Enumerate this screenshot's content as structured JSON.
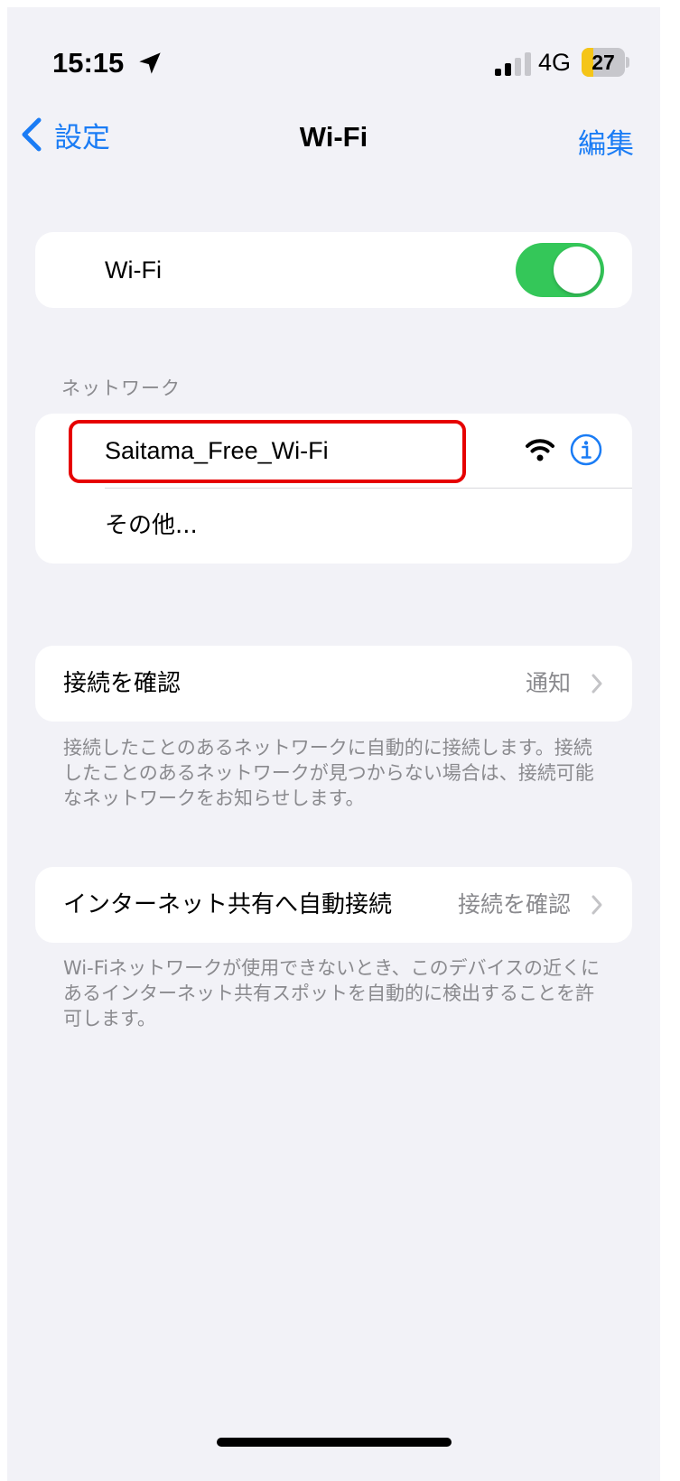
{
  "status_bar": {
    "time": "15:15",
    "network_type": "4G",
    "battery_level": "27",
    "battery_fraction": 0.27,
    "signal_bars_active": 2,
    "signal_bars_total": 4
  },
  "nav": {
    "back_label": "設定",
    "title": "Wi-Fi",
    "edit_label": "編集"
  },
  "wifi_toggle": {
    "label": "Wi-Fi",
    "on": true
  },
  "networks": {
    "header": "ネットワーク",
    "items": [
      {
        "name": "Saitama_Free_Wi-Fi",
        "icon": "wifi-signal-icon",
        "info_icon": "info-icon"
      }
    ],
    "other_label": "その他..."
  },
  "ask_to_join": {
    "label": "接続を確認",
    "value": "通知",
    "footnote": "接続したことのあるネットワークに自動的に接続します。接続したことのあるネットワークが見つからない場合は、接続可能なネットワークをお知らせします。"
  },
  "auto_hotspot": {
    "label": "インターネット共有へ自動接続",
    "value": "接続を確認",
    "footnote": "Wi-Fiネットワークが使用できないとき、このデバイスの近くにあるインターネット共有スポットを自動的に検出することを許可します。"
  },
  "colors": {
    "accent": "#1a7cf5",
    "toggle_on": "#34c759",
    "highlight": "#e60000",
    "battery": "#f5c518"
  }
}
